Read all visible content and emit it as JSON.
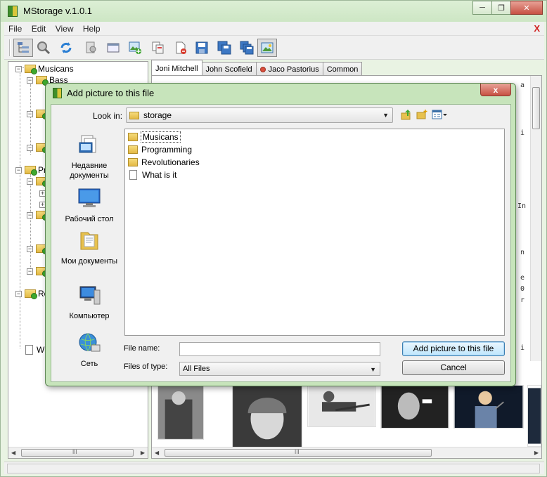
{
  "app": {
    "title": "MStorage v.1.0.1",
    "window_buttons": [
      "─",
      "❐",
      "✕"
    ]
  },
  "menu": {
    "items": [
      "File",
      "Edit",
      "View",
      "Help"
    ],
    "close_glyph": "X"
  },
  "toolbar": {
    "buttons": [
      "tree-view-icon",
      "search-icon",
      "refresh-icon",
      "find-icon",
      "window-icon",
      "add-picture-icon",
      "copy-icon",
      "delete-icon",
      "save-icon",
      "save-as-icon",
      "save-all-icon",
      "picture-icon"
    ]
  },
  "tree": {
    "items": [
      {
        "label": "Musicans"
      },
      {
        "label": "Bass"
      },
      {
        "label": "Pr"
      },
      {
        "label": "Re"
      },
      {
        "label": "Wh"
      }
    ],
    "scroll_glyph": "III"
  },
  "tabs": [
    {
      "label": "Joni Mitchell",
      "active": true
    },
    {
      "label": "John Scofield"
    },
    {
      "label": "Jaco Pastorius",
      "has_dot": true
    },
    {
      "label": "Common"
    }
  ],
  "content": {
    "peek_chars": [
      "a",
      "i",
      "In",
      "n",
      "e",
      "0",
      "r",
      "i"
    ],
    "scroll_glyph": "III"
  },
  "dialog": {
    "title": "Add picture to this file",
    "close_glyph": "x",
    "look_in_label": "Look in:",
    "look_in_value": "storage",
    "places": [
      {
        "label": "Недавние документы",
        "icon": "recent-documents-icon"
      },
      {
        "label": "Рабочий стол",
        "icon": "desktop-icon"
      },
      {
        "label": "Мои документы",
        "icon": "my-documents-icon"
      },
      {
        "label": "Компьютер",
        "icon": "computer-icon"
      },
      {
        "label": "Сеть",
        "icon": "network-icon"
      }
    ],
    "files": [
      {
        "name": "Musicans",
        "type": "folder"
      },
      {
        "name": "Programming",
        "type": "folder"
      },
      {
        "name": "Revolutionaries",
        "type": "folder"
      },
      {
        "name": "What is it",
        "type": "file"
      }
    ],
    "file_name_label": "File name:",
    "file_name_value": "",
    "file_type_label": "Files of type:",
    "file_type_value": "All Files",
    "ok_button": "Add picture to this file",
    "cancel_button": "Cancel"
  },
  "colors": {
    "title_green": "#cde6c4",
    "dialog_frame": "#c7e4bb",
    "close_red": "#c75143"
  }
}
